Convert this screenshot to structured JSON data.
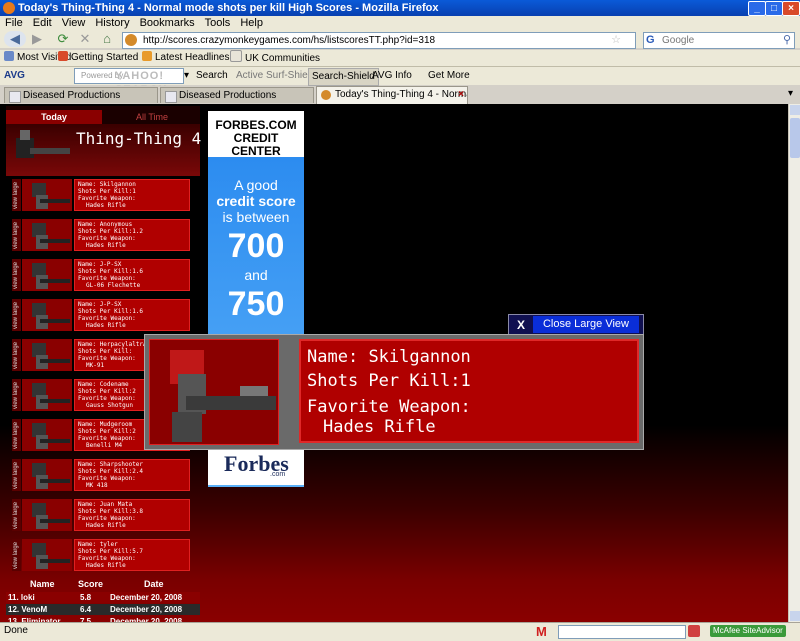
{
  "window": {
    "title": "Today's Thing-Thing 4 - Normal mode shots per kill High Scores - Mozilla Firefox"
  },
  "menu": [
    "File",
    "Edit",
    "View",
    "History",
    "Bookmarks",
    "Tools",
    "Help"
  ],
  "nav": {
    "url": "http://scores.crazymonkeygames.com/hs/listscoresTT.php?id=318",
    "search_placeholder": "Google"
  },
  "bookmarks": [
    "Most Visited",
    "Getting Started",
    "Latest Headlines",
    "UK Communities"
  ],
  "avgbar": {
    "logo": "AVG",
    "search_placeholder": "Powered by",
    "yahoo": "YAHOO! SEARCH",
    "items": [
      "Search",
      "Active Surf-Shield",
      "Search-Shield",
      "AVG Info",
      "Get More"
    ]
  },
  "tabs": [
    {
      "label": "Diseased Productions"
    },
    {
      "label": "Diseased Productions"
    },
    {
      "label": "Today's Thing-Thing 4 - Normal ..."
    }
  ],
  "game": {
    "tab_today": "Today",
    "tab_alltime": "All Time",
    "logo": "Thing-Thing 4",
    "view_large": "view large",
    "labels": {
      "name": "Name:",
      "spk": "Shots Per Kill:",
      "weapon": "Favorite Weapon:"
    },
    "rows": [
      {
        "name": "Skilgannon",
        "spk": "1",
        "weapon": "Hades Rifle"
      },
      {
        "name": "Anonymous",
        "spk": "1.2",
        "weapon": "Hades Rifle"
      },
      {
        "name": "J-P-SX",
        "spk": "1.6",
        "weapon": "GL-06 Flechette"
      },
      {
        "name": "J-P-SX",
        "spk": "1.6",
        "weapon": "Hades Rifle"
      },
      {
        "name": "HerpacylaltrA",
        "spk": "",
        "weapon": "MK-91"
      },
      {
        "name": "Codename",
        "spk": "2",
        "weapon": "Gauss Shotgun"
      },
      {
        "name": "Mudgeroom",
        "spk": "2",
        "weapon": "Benelli M4"
      },
      {
        "name": "Sharpshooter",
        "spk": "2.4",
        "weapon": "MK 418"
      },
      {
        "name": "Juan Mata",
        "spk": "3.8",
        "weapon": "Hades Rifle"
      },
      {
        "name": "tyler",
        "spk": "5.7",
        "weapon": "Hades Rifle"
      }
    ],
    "table": {
      "headers": [
        "Name",
        "Score",
        "Date"
      ],
      "rows": [
        {
          "name": "11. loki",
          "score": "5.8",
          "date": "December 20, 2008"
        },
        {
          "name": "12. VenoM",
          "score": "6.4",
          "date": "December 20, 2008"
        },
        {
          "name": "13. Eliminator",
          "score": "7.5",
          "date": "December 20, 2008"
        }
      ]
    }
  },
  "ad": {
    "brand": "FORBES.COM",
    "title": "CREDIT CENTER",
    "line1": "A good",
    "line2": "credit score",
    "line3": "is between",
    "num1": "700",
    "and": "and",
    "num2": "750",
    "footer": "Forbes",
    "footer_sub": ".com"
  },
  "popup": {
    "close_x": "X",
    "close_label": "Close Large View",
    "name_label": "Name:",
    "name": "Skilgannon",
    "spk_label": "Shots Per Kill:",
    "spk": "1",
    "weapon_label": "Favorite Weapon:",
    "weapon": "Hades Rifle"
  },
  "status": {
    "text": "Done",
    "mcafee": "McAfee SiteAdvisor"
  }
}
